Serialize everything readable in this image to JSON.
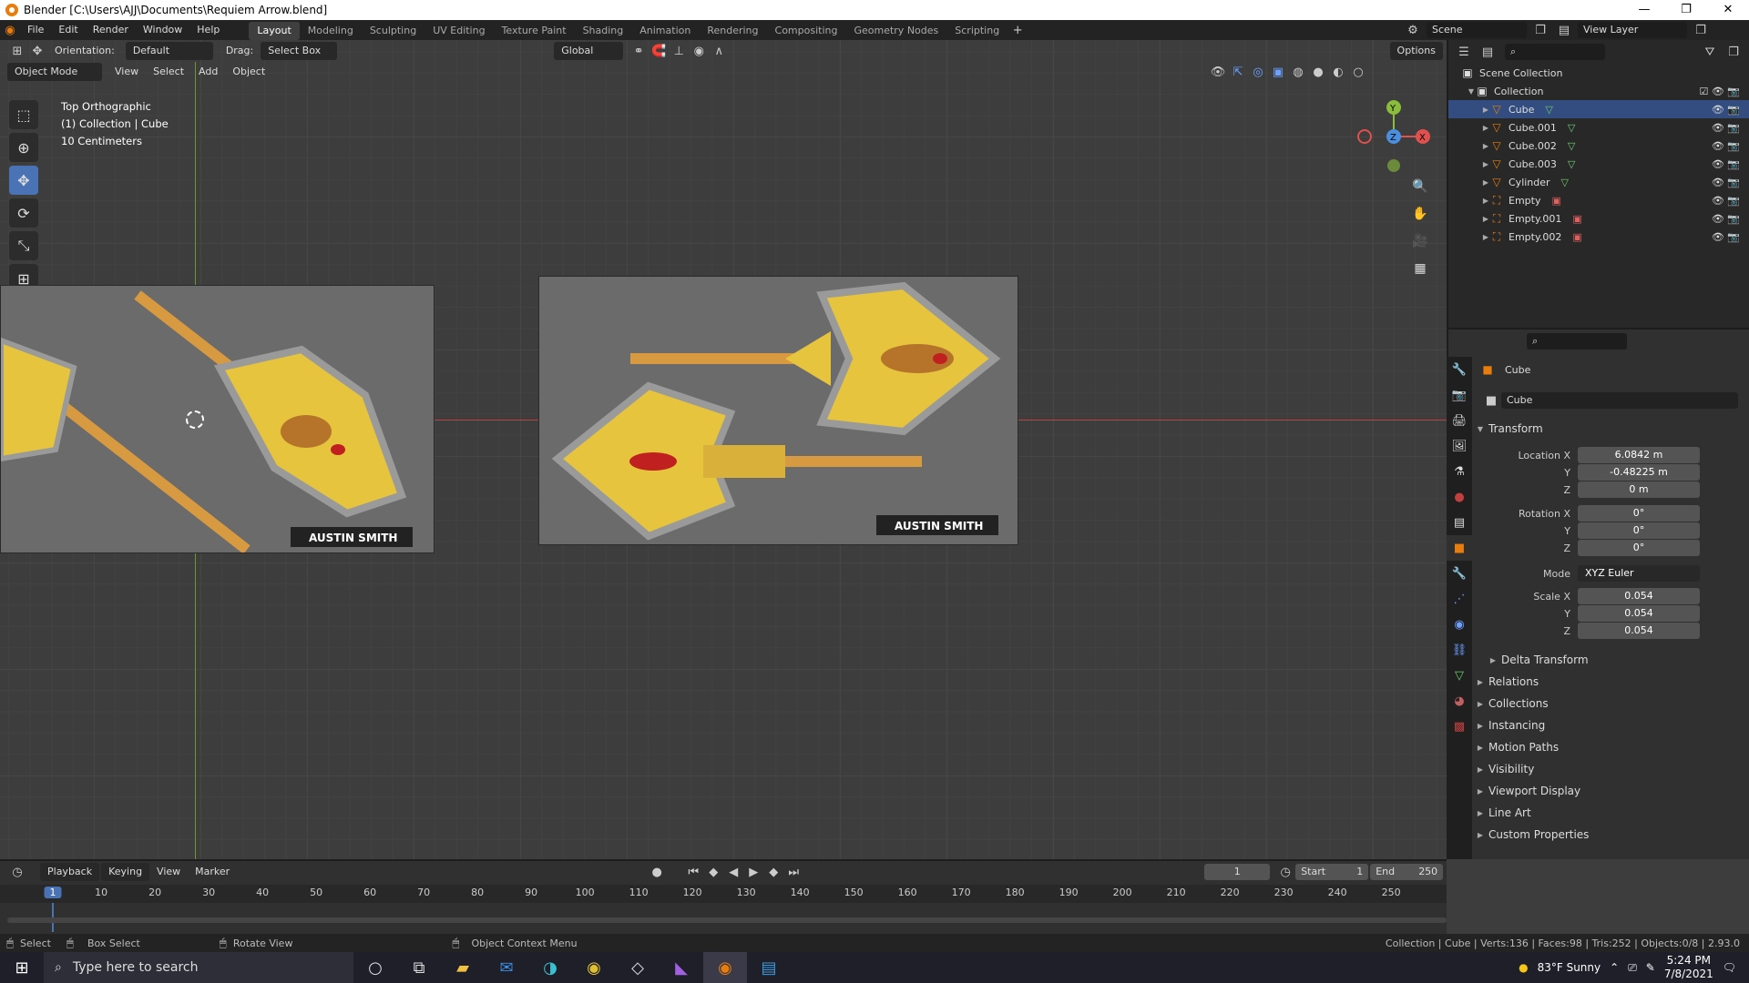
{
  "window": {
    "title": "Blender [C:\\Users\\AJJ\\Documents\\Requiem Arrow.blend]",
    "minimize": "—",
    "maximize": "❐",
    "close": "✕"
  },
  "menu": [
    "File",
    "Edit",
    "Render",
    "Window",
    "Help"
  ],
  "workspaces": [
    "Layout",
    "Modeling",
    "Sculpting",
    "UV Editing",
    "Texture Paint",
    "Shading",
    "Animation",
    "Rendering",
    "Compositing",
    "Geometry Nodes",
    "Scripting"
  ],
  "active_workspace": "Layout",
  "scene": "Scene",
  "view_layer": "View Layer",
  "viewport_header": {
    "orientation_label": "Orientation:",
    "orientation": "Default",
    "drag_label": "Drag:",
    "drag": "Select Box",
    "transform": "Global",
    "options": "Options",
    "mode": "Object Mode",
    "menus": [
      "View",
      "Select",
      "Add",
      "Object"
    ]
  },
  "viewport_overlay": {
    "view": "Top Orthographic",
    "collection": "(1) Collection | Cube",
    "scale": "10 Centimeters"
  },
  "ref_images": [
    {
      "label": "AUSTIN SMITH"
    },
    {
      "label": "AUSTIN SMITH"
    }
  ],
  "gizmo": {
    "x": "X",
    "y": "Y",
    "z": "Z"
  },
  "outliner": {
    "root": "Scene Collection",
    "collection": "Collection",
    "items": [
      {
        "name": "Cube",
        "type": "mesh"
      },
      {
        "name": "Cube.001",
        "type": "mesh"
      },
      {
        "name": "Cube.002",
        "type": "mesh"
      },
      {
        "name": "Cube.003",
        "type": "mesh"
      },
      {
        "name": "Cylinder",
        "type": "mesh"
      },
      {
        "name": "Empty",
        "type": "empty"
      },
      {
        "name": "Empty.001",
        "type": "empty"
      },
      {
        "name": "Empty.002",
        "type": "empty"
      }
    ]
  },
  "properties": {
    "object_name": "Cube",
    "data_name": "Cube",
    "transform_label": "Transform",
    "location": {
      "label": "Location X",
      "x": "6.0842 m",
      "y": "-0.48225 m",
      "z": "0 m"
    },
    "rotation": {
      "label": "Rotation X",
      "x": "0°",
      "y": "0°",
      "z": "0°"
    },
    "mode": {
      "label": "Mode",
      "value": "XYZ Euler"
    },
    "scale": {
      "label": "Scale X",
      "x": "0.054",
      "y": "0.054",
      "z": "0.054"
    },
    "axis_y": "Y",
    "axis_z": "Z",
    "delta": "Delta Transform",
    "panels": [
      "Relations",
      "Collections",
      "Instancing",
      "Motion Paths",
      "Visibility",
      "Viewport Display",
      "Line Art",
      "Custom Properties"
    ]
  },
  "timeline": {
    "menus": [
      "Playback",
      "Keying",
      "View",
      "Marker"
    ],
    "current_frame": "1",
    "start_label": "Start",
    "start": "1",
    "end_label": "End",
    "end": "250",
    "ticks": [
      "1",
      "10",
      "20",
      "30",
      "40",
      "50",
      "60",
      "70",
      "80",
      "90",
      "100",
      "110",
      "120",
      "130",
      "140",
      "150",
      "160",
      "170",
      "180",
      "190",
      "200",
      "210",
      "220",
      "230",
      "240",
      "250"
    ]
  },
  "status": {
    "select": "Select",
    "box_select": "Box Select",
    "rotate_view": "Rotate View",
    "context_menu": "Object Context Menu",
    "info": "Collection | Cube | Verts:136 | Faces:98 | Tris:252 | Objects:0/8 | 2.93.0"
  },
  "taskbar": {
    "search_placeholder": "Type here to search",
    "weather": "83°F  Sunny",
    "time": "5:24 PM",
    "date": "7/8/2021"
  }
}
